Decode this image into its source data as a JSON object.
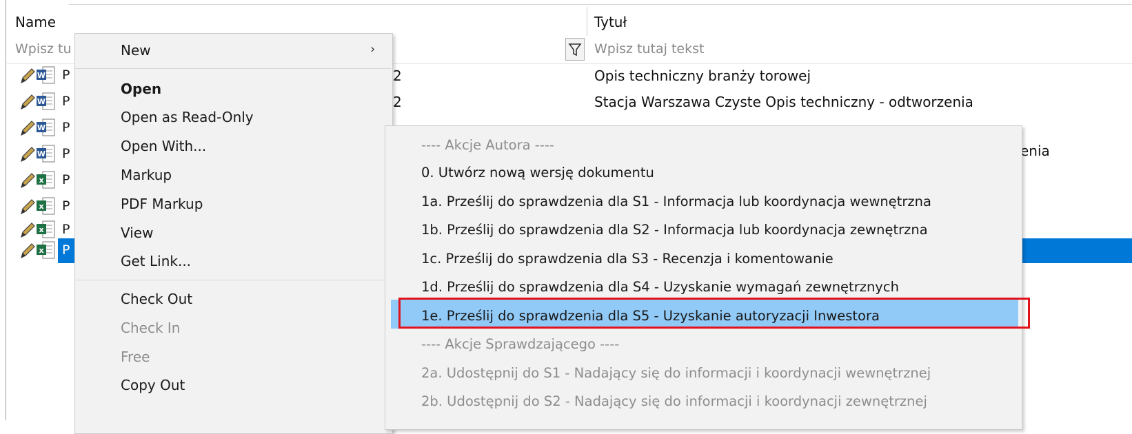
{
  "list": {
    "columns": {
      "name": "Name",
      "title": "Tytuł"
    },
    "filters": {
      "name_placeholder": "Wpisz tu",
      "title_placeholder": "Wpisz tutaj tekst"
    },
    "rows": [
      {
        "name_stub": "P",
        "type": "word",
        "digit": "2",
        "title": "Opis techniczny branży torowej"
      },
      {
        "name_stub": "P",
        "type": "word",
        "digit": "2",
        "title": "Stacja Warszawa Czyste Opis techniczny - odtworzenia"
      },
      {
        "name_stub": "P",
        "type": "word",
        "digit": "",
        "title": ""
      },
      {
        "name_stub": "P",
        "type": "word",
        "digit": "",
        "title": ""
      },
      {
        "name_stub": "P",
        "type": "excel",
        "digit": "",
        "title": ""
      },
      {
        "name_stub": "P",
        "type": "excel",
        "digit": "",
        "title": ""
      },
      {
        "name_stub": "P",
        "type": "excel",
        "digit": "",
        "title": ""
      },
      {
        "name_stub": "P",
        "type": "excel",
        "digit": "",
        "title": "",
        "selected": true
      }
    ],
    "row4_tail": "enia"
  },
  "context_menu": {
    "items": [
      {
        "label": "New",
        "submenu": true
      },
      {
        "label": "Open",
        "bold": true
      },
      {
        "label": "Open as Read-Only"
      },
      {
        "label": "Open With..."
      },
      {
        "label": "Markup"
      },
      {
        "label": "PDF Markup"
      },
      {
        "label": "View"
      },
      {
        "label": "Get Link..."
      },
      {
        "label": "Check Out"
      },
      {
        "label": "Check In",
        "disabled": true
      },
      {
        "label": "Free",
        "disabled": true
      },
      {
        "label": "Copy Out"
      }
    ]
  },
  "submenu": {
    "items": [
      {
        "label": "---- Akcje Autora ----",
        "header": true
      },
      {
        "label": "0. Utwórz nową wersję dokumentu"
      },
      {
        "label": "1a. Prześlij do sprawdzenia dla S1 - Informacja lub koordynacja wewnętrzna"
      },
      {
        "label": "1b. Prześlij do sprawdzenia dla S2 - Informacja lub koordynacja zewnętrzna"
      },
      {
        "label": "1c. Prześlij do sprawdzenia dla S3 - Recenzja i komentowanie"
      },
      {
        "label": "1d. Prześlij do sprawdzenia dla S4 - Uzyskanie wymagań zewnętrznych"
      },
      {
        "label": "1e. Prześlij do sprawdzenia dla S5 - Uzyskanie autoryzacji Inwestora",
        "highlighted": true
      },
      {
        "label": "---- Akcje Sprawdzającego ----",
        "header": true
      },
      {
        "label": "2a. Udostępnij do S1 - Nadający się do informacji i koordynacji wewnętrznej",
        "disabled": true
      },
      {
        "label": "2b. Udostępnij do S2 - Nadający się do informacji i koordynacji zewnętrznej",
        "disabled": true
      }
    ]
  },
  "colors": {
    "selection": "#0078d7",
    "menu_highlight": "#91c9f7",
    "annotation_box": "#e3111b"
  }
}
